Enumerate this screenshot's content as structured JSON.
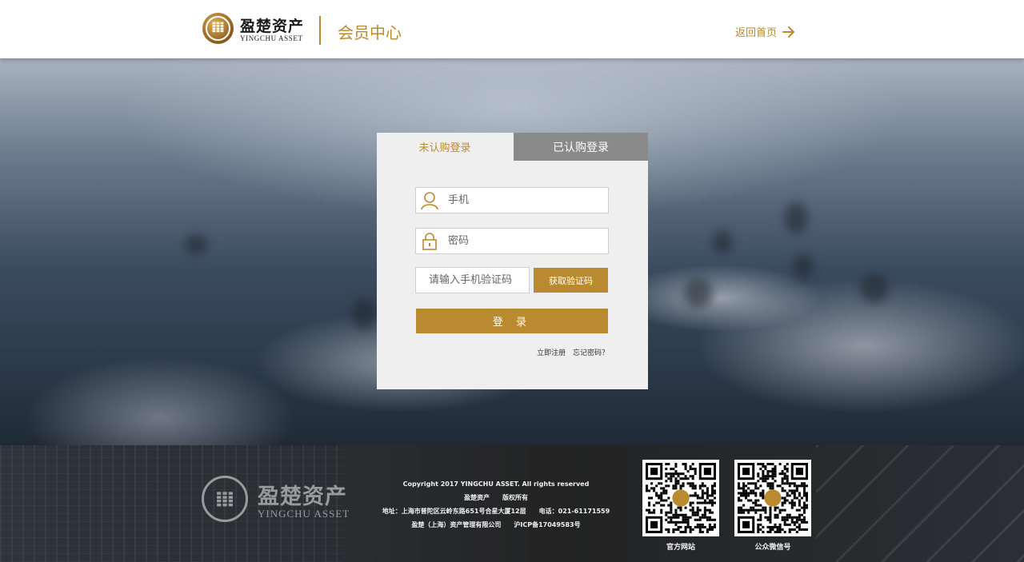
{
  "header": {
    "logo_cn": "盈楚资产",
    "logo_en": "YINGCHU ASSET",
    "title": "会员中心",
    "back_home": "返回首页"
  },
  "login": {
    "tabs": [
      {
        "label": "未认购登录",
        "active": true
      },
      {
        "label": "已认购登录",
        "active": false
      }
    ],
    "phone_placeholder": "手机",
    "password_placeholder": "密码",
    "code_placeholder": "请输入手机验证码",
    "get_code_label": "获取验证码",
    "login_label": "登 录",
    "register_link": "立即注册",
    "forgot_link": "忘记密码？"
  },
  "footer": {
    "logo_cn": "盈楚资产",
    "logo_en": "YINGCHU ASSET",
    "copyright": "Copyright 2017 YINGCHU ASSET. All rights reserved",
    "rights": "盈楚资产　　版权所有",
    "address": "地址：上海市普陀区云岭东路651号合星大厦12层　　电话：021-61171559",
    "company": "盈楚（上海）资产管理有限公司　　沪ICP备17049583号",
    "qr_website_label": "官方网站",
    "qr_wechat_label": "公众微信号"
  },
  "colors": {
    "accent": "#b98a2f",
    "tab_inactive": "#8a8a8a",
    "card_bg": "#efefef",
    "header_bg": "#ffffff"
  }
}
